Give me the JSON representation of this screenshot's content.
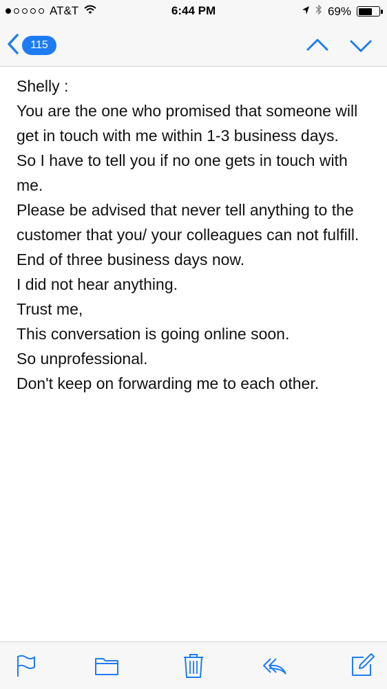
{
  "status_bar": {
    "carrier": "AT&T",
    "time": "6:44 PM",
    "battery": "69%",
    "battery_level": 0.69,
    "signal_bars_filled": 1,
    "signal_bars_total": 5,
    "icons": [
      "wifi-icon",
      "location-arrow-icon",
      "bluetooth-icon",
      "battery-icon"
    ]
  },
  "nav": {
    "unread_count": "115",
    "accent_color": "#1e7cf2",
    "icons": [
      "back-chevron-icon",
      "chevron-up-icon",
      "chevron-down-icon"
    ]
  },
  "message": {
    "lines": [
      "Shelly :",
      "",
      "You are the one who promised that someone will get in touch with me within 1-3 business days.",
      "So I have to tell you if no one gets in touch with me.",
      "",
      "",
      "",
      "Please be advised that never tell anything to the customer that you/ your colleagues can not fulfill.",
      "",
      "End of three business days now.",
      "I did not hear anything.",
      "",
      "Trust me,",
      "This conversation is going online soon.",
      "",
      "So unprofessional.",
      "",
      "Don't keep on forwarding me to each other."
    ]
  },
  "toolbar": {
    "icons": [
      "flag-icon",
      "folder-icon",
      "trash-icon",
      "reply-icon",
      "compose-icon"
    ]
  }
}
